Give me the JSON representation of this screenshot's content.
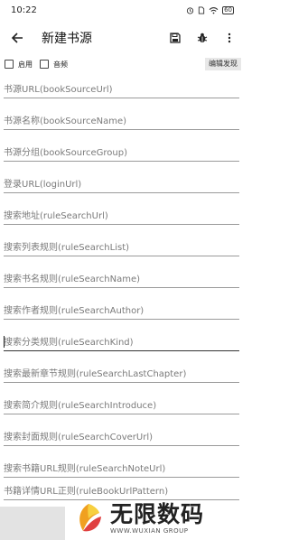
{
  "status_bar": {
    "time": "10:22",
    "battery": "60"
  },
  "toolbar": {
    "title": "新建书源"
  },
  "options": {
    "enabled_label": "启用",
    "audio_label": "音频",
    "edit_discovery_label": "编辑发现"
  },
  "fields": [
    {
      "placeholder": "书源URL(bookSourceUrl)"
    },
    {
      "placeholder": "书源名称(bookSourceName)"
    },
    {
      "placeholder": "书源分组(bookSourceGroup)"
    },
    {
      "placeholder": "登录URL(loginUrl)"
    },
    {
      "placeholder": "搜索地址(ruleSearchUrl)"
    },
    {
      "placeholder": "搜索列表规则(ruleSearchList)"
    },
    {
      "placeholder": "搜索书名规则(ruleSearchName)"
    },
    {
      "placeholder": "搜索作者规则(ruleSearchAuthor)"
    },
    {
      "placeholder": "搜索分类规则(ruleSearchKind)"
    },
    {
      "placeholder": "搜索最新章节规则(ruleSearchLastChapter)"
    },
    {
      "placeholder": "搜索简介规则(ruleSearchIntroduce)"
    },
    {
      "placeholder": "搜索封面规则(ruleSearchCoverUrl)"
    },
    {
      "placeholder": "搜索书籍URL规则(ruleSearchNoteUrl)"
    },
    {
      "placeholder": "书籍详情URL正则(ruleBookUrlPattern)"
    }
  ],
  "watermark": {
    "main": "无限数码",
    "sub": "WWW.WUXIAN GROUP"
  },
  "colors": {
    "text": "#222222",
    "hint": "#7a7a7a",
    "divider": "#9a9a9a"
  }
}
